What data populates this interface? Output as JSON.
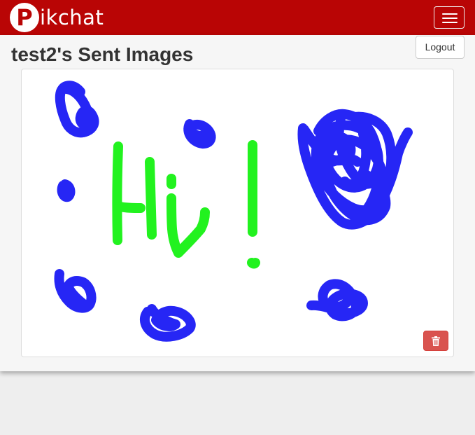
{
  "navbar": {
    "brand_letter": "P",
    "brand_text": "ikchat",
    "toggle_icon": "hamburger-icon",
    "color": "#b90505"
  },
  "header": {
    "title": "test2's Sent Images",
    "logout_label": "Logout"
  },
  "image_card": {
    "delete_icon": "trash-icon",
    "delete_color": "#d9534f",
    "stroke_colors": [
      "#2626f5",
      "#22f21f"
    ]
  }
}
